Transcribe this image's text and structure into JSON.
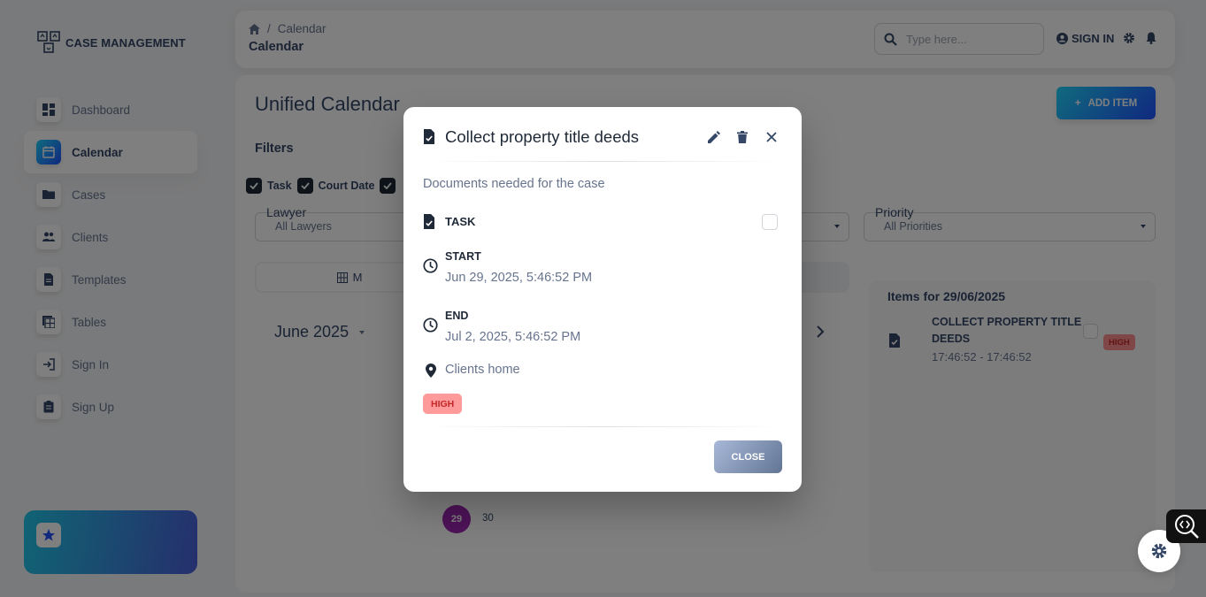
{
  "app": {
    "brand": "CASE MANAGEMENT"
  },
  "sidebar": {
    "items": [
      {
        "label": "Dashboard",
        "icon": "dashboard-icon"
      },
      {
        "label": "Calendar",
        "icon": "calendar-icon",
        "active": true
      },
      {
        "label": "Cases",
        "icon": "folder-icon"
      },
      {
        "label": "Clients",
        "icon": "people-icon"
      },
      {
        "label": "Templates",
        "icon": "document-icon"
      },
      {
        "label": "Tables",
        "icon": "table-icon"
      },
      {
        "label": "Sign In",
        "icon": "login-icon"
      },
      {
        "label": "Sign Up",
        "icon": "assignment-icon"
      }
    ]
  },
  "header": {
    "breadcrumb": [
      "Calendar"
    ],
    "page_title": "Calendar",
    "search_placeholder": "Type here...",
    "signin_label": "SIGN IN"
  },
  "main": {
    "title": "Unified Calendar",
    "add_label": "ADD ITEM",
    "filters_label": "Filters",
    "filter_checks": [
      "Task",
      "Court Date"
    ],
    "lawyer": {
      "label": "Lawyer",
      "value": "All Lawyers"
    },
    "priority": {
      "label": "Priority",
      "value": "All Priorities"
    },
    "view_tab_label": "M",
    "month": "June 2025",
    "days": [
      "29",
      "30"
    ],
    "items_panel": {
      "title": "Items for 29/06/2025",
      "items": [
        {
          "title": "COLLECT PROPERTY TITLE DEEDS",
          "time": "17:46:52 - 17:46:52",
          "priority": "HIGH"
        }
      ]
    }
  },
  "dialog": {
    "title": "Collect property title deeds",
    "description": "Documents needed for the case",
    "type": "TASK",
    "start_label": "START",
    "start_value": "Jun 29, 2025, 5:46:52 PM",
    "end_label": "END",
    "end_value": "Jul 2, 2025, 5:46:52 PM",
    "location": "Clients home",
    "priority": "HIGH",
    "close_label": "CLOSE"
  },
  "colors": {
    "accent": "#17c1e8",
    "priority_high_bg": "#ff9a9a",
    "priority_high_text": "#c62828",
    "day_highlight": "#9c27b0"
  }
}
